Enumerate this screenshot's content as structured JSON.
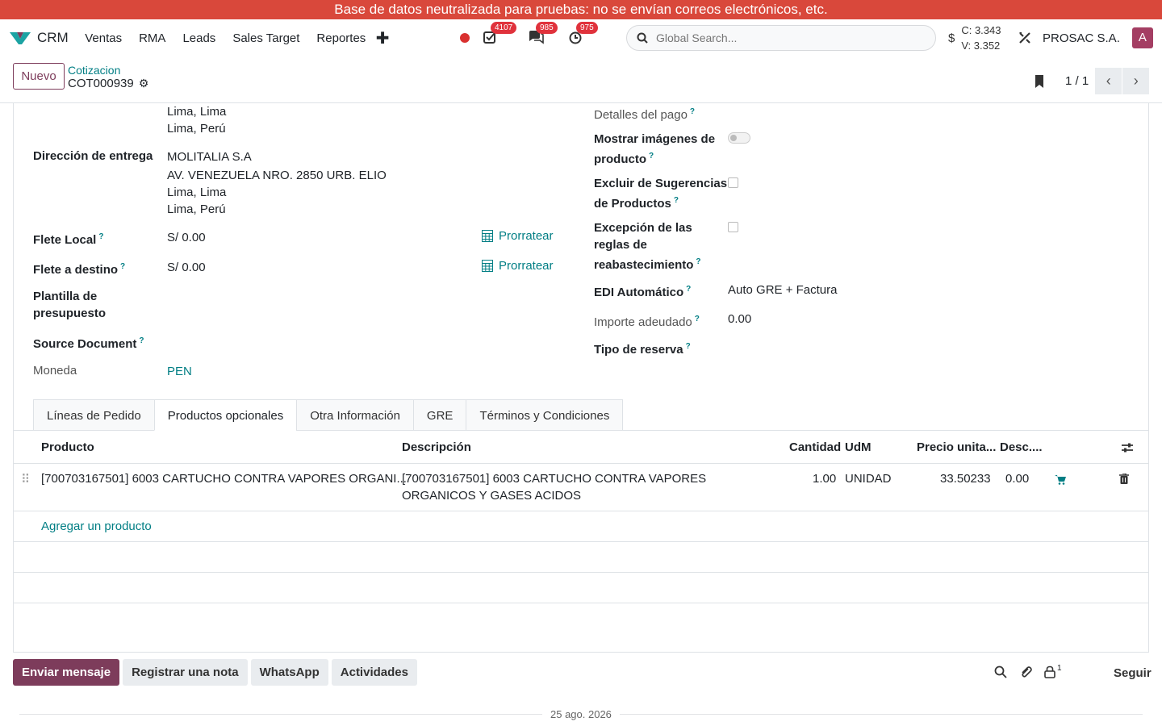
{
  "banner": "Base de datos neutralizada para pruebas: no se envían correos electrónicos, etc.",
  "navbar": {
    "brand": "CRM",
    "menu": [
      "Ventas",
      "RMA",
      "Leads",
      "Sales Target",
      "Reportes"
    ],
    "badges": {
      "activities": "4107",
      "messages": "985",
      "timers": "975"
    },
    "search_placeholder": "Global Search...",
    "rate_c": "C: 3.343",
    "rate_v": "V: 3.352",
    "company": "PROSAC S.A.",
    "avatar": "A",
    "colors": {
      "accent": "#017e84",
      "brand": "#7d3c5b",
      "banner": "#d9483b"
    }
  },
  "control": {
    "new_button": "Nuevo",
    "breadcrumb_parent": "Cotizacion",
    "breadcrumb_current": "COT000939",
    "pager": "1 / 1"
  },
  "form": {
    "address_tail": [
      "Lima, Lima",
      "Lima, Perú"
    ],
    "delivery_label": "Dirección de entrega",
    "delivery_lines": [
      "MOLITALIA S.A",
      "AV. VENEZUELA NRO. 2850 URB. ELIO",
      "Lima, Lima",
      "Lima, Perú"
    ],
    "flete_local_label": "Flete Local",
    "flete_local_value": "S/ 0.00",
    "flete_destino_label": "Flete a destino",
    "flete_destino_value": "S/ 0.00",
    "prorratear": "Prorratear",
    "plantilla_label_1": "Plantilla de",
    "plantilla_label_2": "presupuesto",
    "source_label": "Source Document",
    "moneda_label": "Moneda",
    "moneda_value": "PEN",
    "detalles_pago_label": "Detalles del pago",
    "mostrar_label_1": "Mostrar imágenes de",
    "mostrar_label_2": "producto",
    "excluir_label_1": "Excluir de Sugerencias",
    "excluir_label_2": "de Productos",
    "excepcion_label_1": "Excepción de las",
    "excepcion_label_2": "reglas de",
    "excepcion_label_3": "reabastecimiento",
    "edi_label": "EDI Automático",
    "edi_value": "Auto GRE + Factura",
    "importe_label": "Importe adeudado",
    "importe_value": "0.00",
    "tipo_reserva_label": "Tipo de reserva"
  },
  "tabs": [
    "Líneas de Pedido",
    "Productos opcionales",
    "Otra Información",
    "GRE",
    "Términos y Condiciones"
  ],
  "table": {
    "headers": [
      "Producto",
      "Descripción",
      "Cantidad",
      "UdM",
      "Precio unita...",
      "Desc...."
    ],
    "rows": [
      {
        "product": "[700703167501] 6003 CARTUCHO CONTRA VAPORES ORGANI...",
        "description_1": "[700703167501] 6003 CARTUCHO CONTRA VAPORES",
        "description_2": "ORGANICOS Y GASES ACIDOS",
        "qty": "1.00",
        "uom": "UNIDAD",
        "price": "33.50233",
        "discount": "0.00"
      }
    ],
    "add_line": "Agregar un producto"
  },
  "chatter": {
    "send": "Enviar mensaje",
    "note": "Registrar una nota",
    "whatsapp": "WhatsApp",
    "activities": "Actividades",
    "followers_count": "1",
    "follow": "Seguir",
    "date": "25 ago. 2026"
  }
}
